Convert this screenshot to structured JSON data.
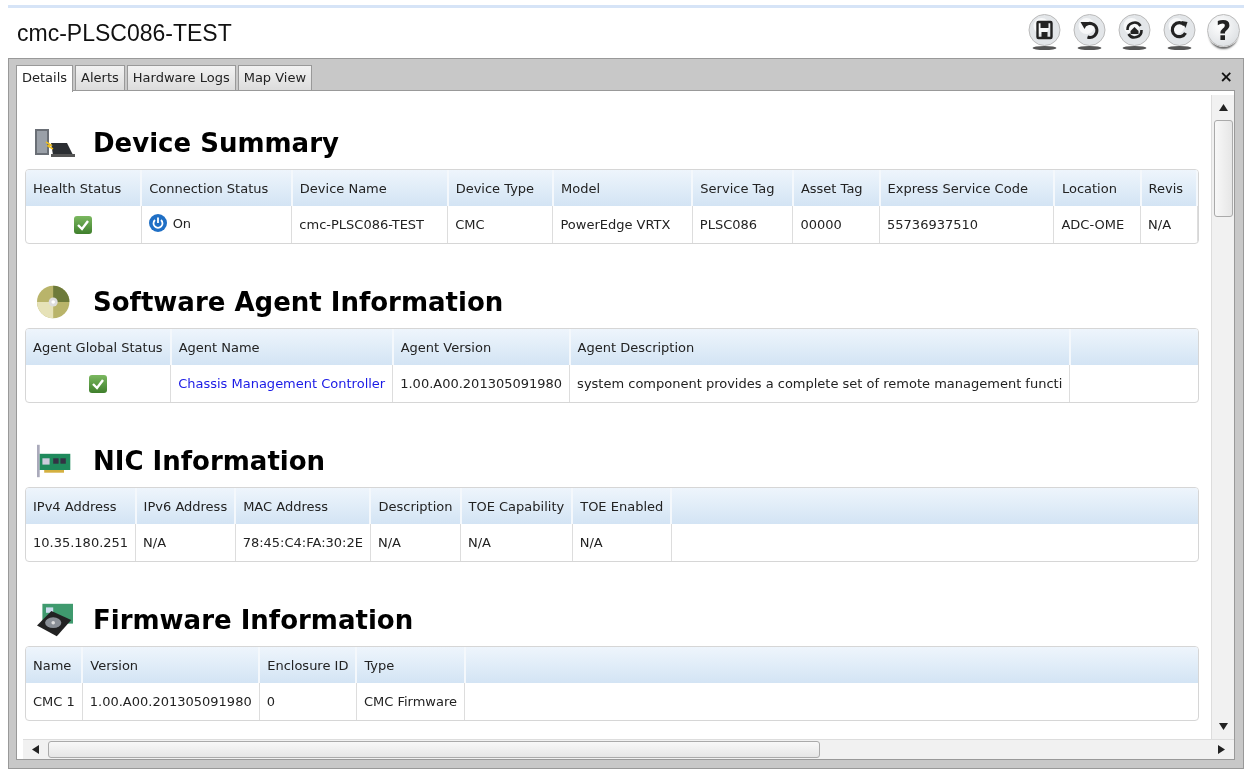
{
  "window": {
    "title": "cmc-PLSC086-TEST",
    "toolbar": [
      {
        "kind": "save"
      },
      {
        "kind": "undo"
      },
      {
        "kind": "home-refresh"
      },
      {
        "kind": "refresh"
      },
      {
        "kind": "help",
        "text": "?"
      }
    ]
  },
  "tabs": [
    {
      "label": "Details",
      "selected": true
    },
    {
      "label": "Alerts",
      "selected": false
    },
    {
      "label": "Hardware Logs",
      "selected": false
    },
    {
      "label": "Map View",
      "selected": false
    }
  ],
  "close": "×",
  "sections": [
    {
      "title": "Device Summary",
      "columns": [
        "Health Status",
        "Connection Status",
        "Device Name",
        "Device Type",
        "Model",
        "Service Tag",
        "Asset Tag",
        "Express Service Code",
        "Location",
        "Revis"
      ],
      "rows": [
        [
          {
            "kind": "check"
          },
          {
            "kind": "power",
            "text": "On"
          },
          "cmc-PLSC086-TEST",
          "CMC",
          "PowerEdge VRTX",
          "PLSC086",
          "00000",
          "55736937510",
          "ADC-OME",
          "N/A"
        ]
      ]
    },
    {
      "title": "Software Agent Information",
      "columns": [
        "Agent Global Status",
        "Agent Name",
        "Agent Version",
        "Agent Description"
      ],
      "rows": [
        [
          {
            "kind": "check"
          },
          {
            "kind": "link",
            "text": "Chassis Management Controller"
          },
          "1.00.A00.201305091980",
          "system component provides a complete set of remote management functi"
        ]
      ]
    },
    {
      "title": "NIC Information",
      "columns": [
        "IPv4 Address",
        "IPv6 Address",
        "MAC Address",
        "Description",
        "TOE Capability",
        "TOE Enabled"
      ],
      "rows": [
        [
          "10.35.180.251",
          "N/A",
          "78:45:C4:FA:30:2E",
          "N/A",
          "N/A",
          "N/A"
        ]
      ]
    },
    {
      "title": "Firmware Information",
      "columns": [
        "Name",
        "Version",
        "Enclosure ID",
        "Type"
      ],
      "rows": [
        [
          "CMC 1",
          "1.00.A00.201305091980",
          "0",
          "CMC Firmware"
        ]
      ]
    }
  ]
}
